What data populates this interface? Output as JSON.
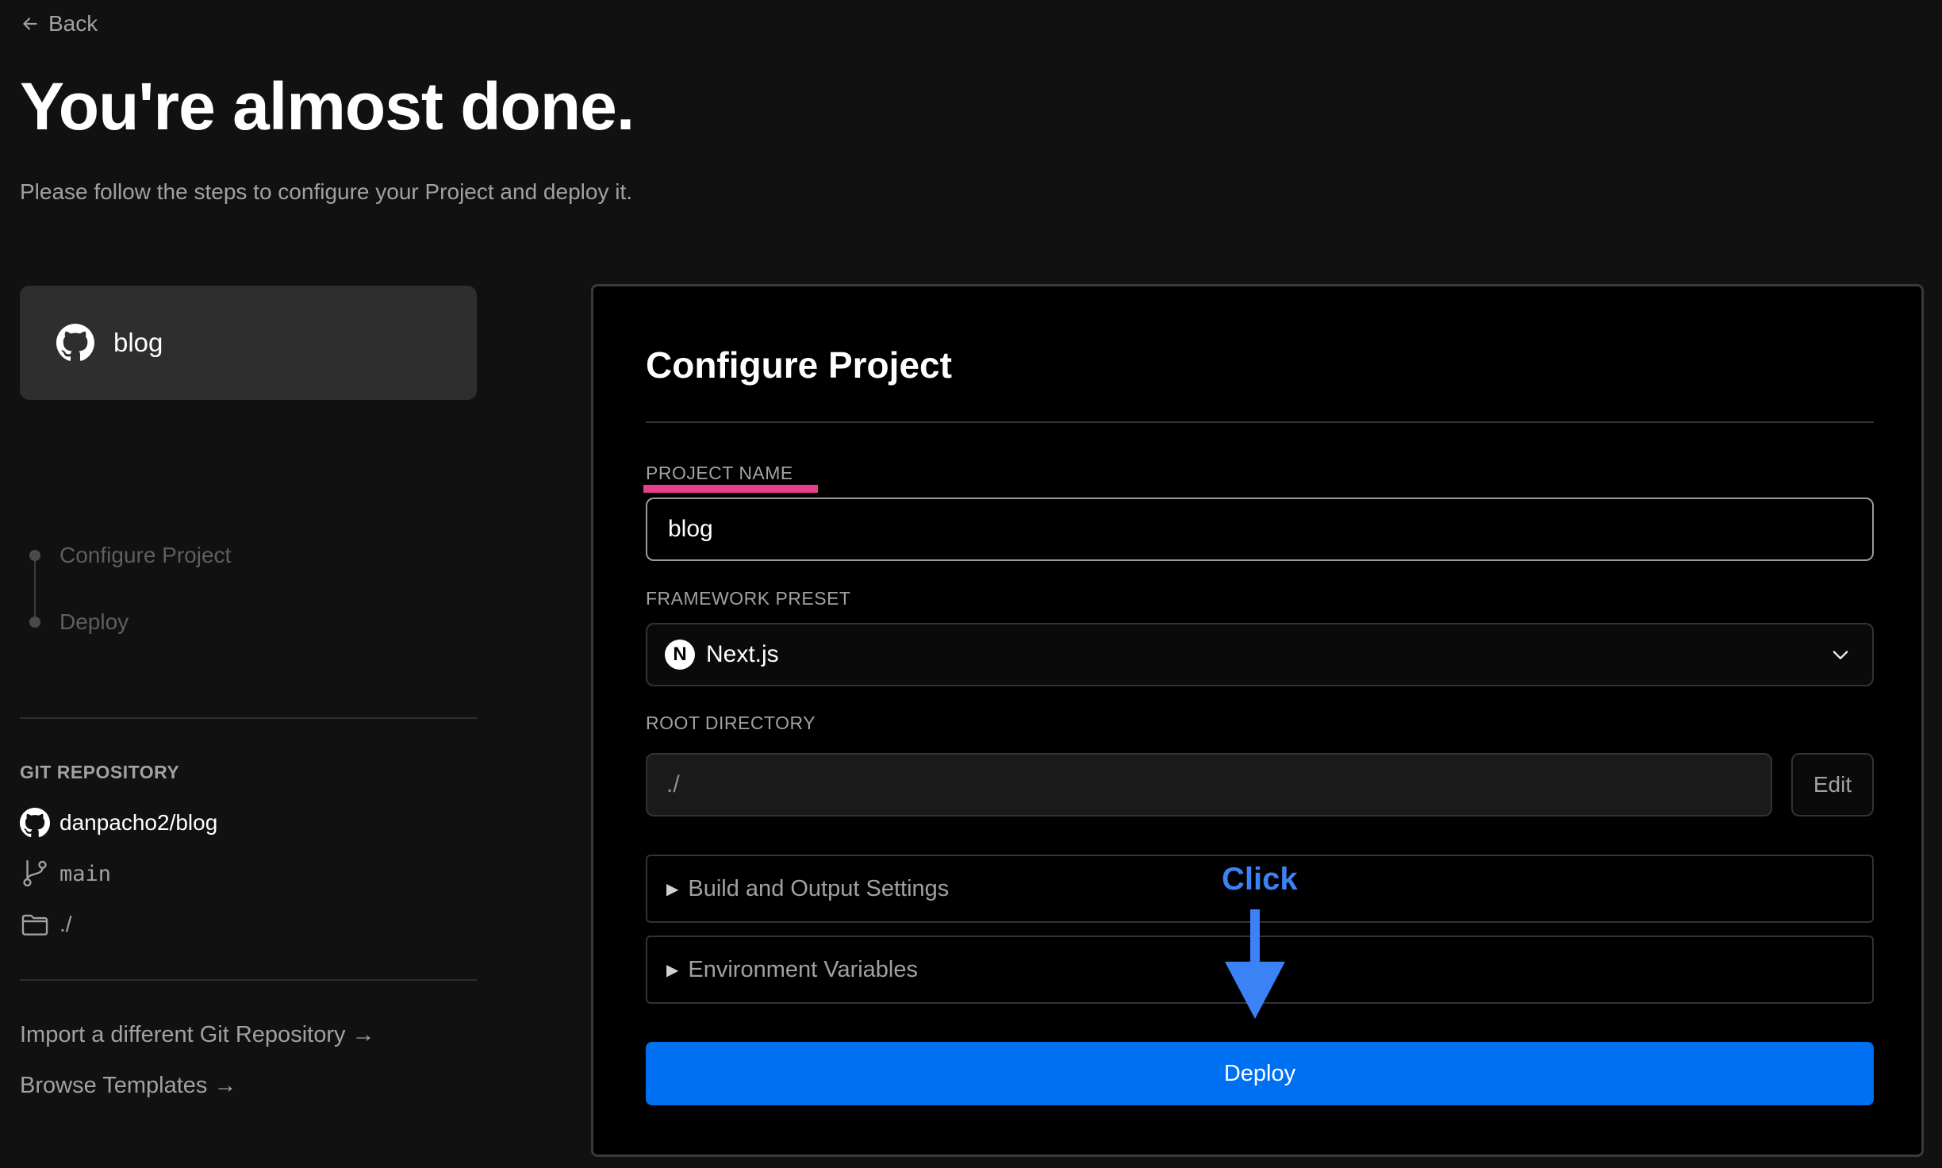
{
  "header": {
    "back_label": "Back",
    "title": "You're almost done.",
    "subtitle": "Please follow the steps to configure your Project and deploy it."
  },
  "sidebar": {
    "repo_card_name": "blog",
    "steps": [
      {
        "label": "Configure Project"
      },
      {
        "label": "Deploy"
      }
    ],
    "git_section_label": "GIT REPOSITORY",
    "git_repo": "danpacho2/blog",
    "git_branch": "main",
    "git_directory": "./",
    "links": [
      {
        "label": "Import a different Git Repository →"
      },
      {
        "label": "Browse Templates →"
      }
    ]
  },
  "configure": {
    "title": "Configure Project",
    "project_name_label": "PROJECT NAME",
    "project_name_value": "blog",
    "framework_label": "FRAMEWORK PRESET",
    "framework_value": "Next.js",
    "framework_logo_letter": "N",
    "root_label": "ROOT DIRECTORY",
    "root_value": "./",
    "edit_label": "Edit",
    "build_settings_label": "Build and Output Settings",
    "env_vars_label": "Environment Variables",
    "deploy_label": "Deploy"
  },
  "annotation": {
    "text": "Click",
    "color": "#3b82f6",
    "highlight_color": "#e83e8c"
  },
  "colors": {
    "background": "#111111",
    "panel": "#000000",
    "accent": "#0070f3"
  },
  "icons": [
    "arrow-left-icon",
    "github-icon",
    "git-branch-icon",
    "folder-icon",
    "chevron-down-icon",
    "nextjs-logo-icon",
    "triangle-right-icon"
  ]
}
